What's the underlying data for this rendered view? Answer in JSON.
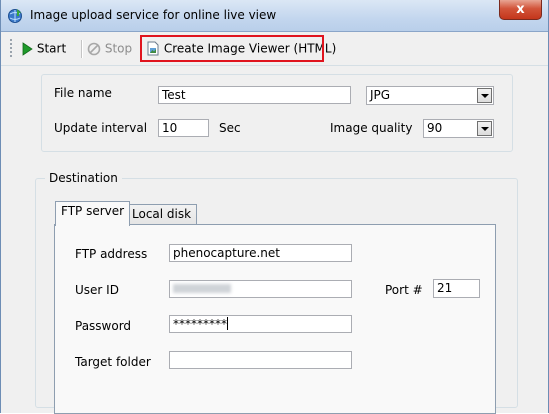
{
  "window": {
    "title": "Image upload service for online live view",
    "close_glyph": "x"
  },
  "toolbar": {
    "start_label": "Start",
    "stop_label": "Stop",
    "create_viewer_label": "Create Image Viewer (HTML)"
  },
  "settings": {
    "file_name_label": "File name",
    "file_name_value": "Test",
    "format_value": "JPG",
    "update_interval_label": "Update interval",
    "update_interval_value": "10",
    "update_interval_unit": "Sec",
    "image_quality_label": "Image quality",
    "image_quality_value": "90"
  },
  "destination": {
    "legend": "Destination",
    "tabs": [
      {
        "label": "FTP server",
        "active": true
      },
      {
        "label": "Local disk",
        "active": false
      }
    ],
    "ftp": {
      "address_label": "FTP address",
      "address_value": "phenocapture.net",
      "user_id_label": "User ID",
      "user_id_value": "",
      "port_label": "Port #",
      "port_value": "21",
      "password_label": "Password",
      "password_value": "*********",
      "target_folder_label": "Target folder",
      "target_folder_value": ""
    }
  },
  "colors": {
    "highlight": "#e0141e",
    "start_icon": "#1e9a2a",
    "close_button": "#c4361b"
  }
}
